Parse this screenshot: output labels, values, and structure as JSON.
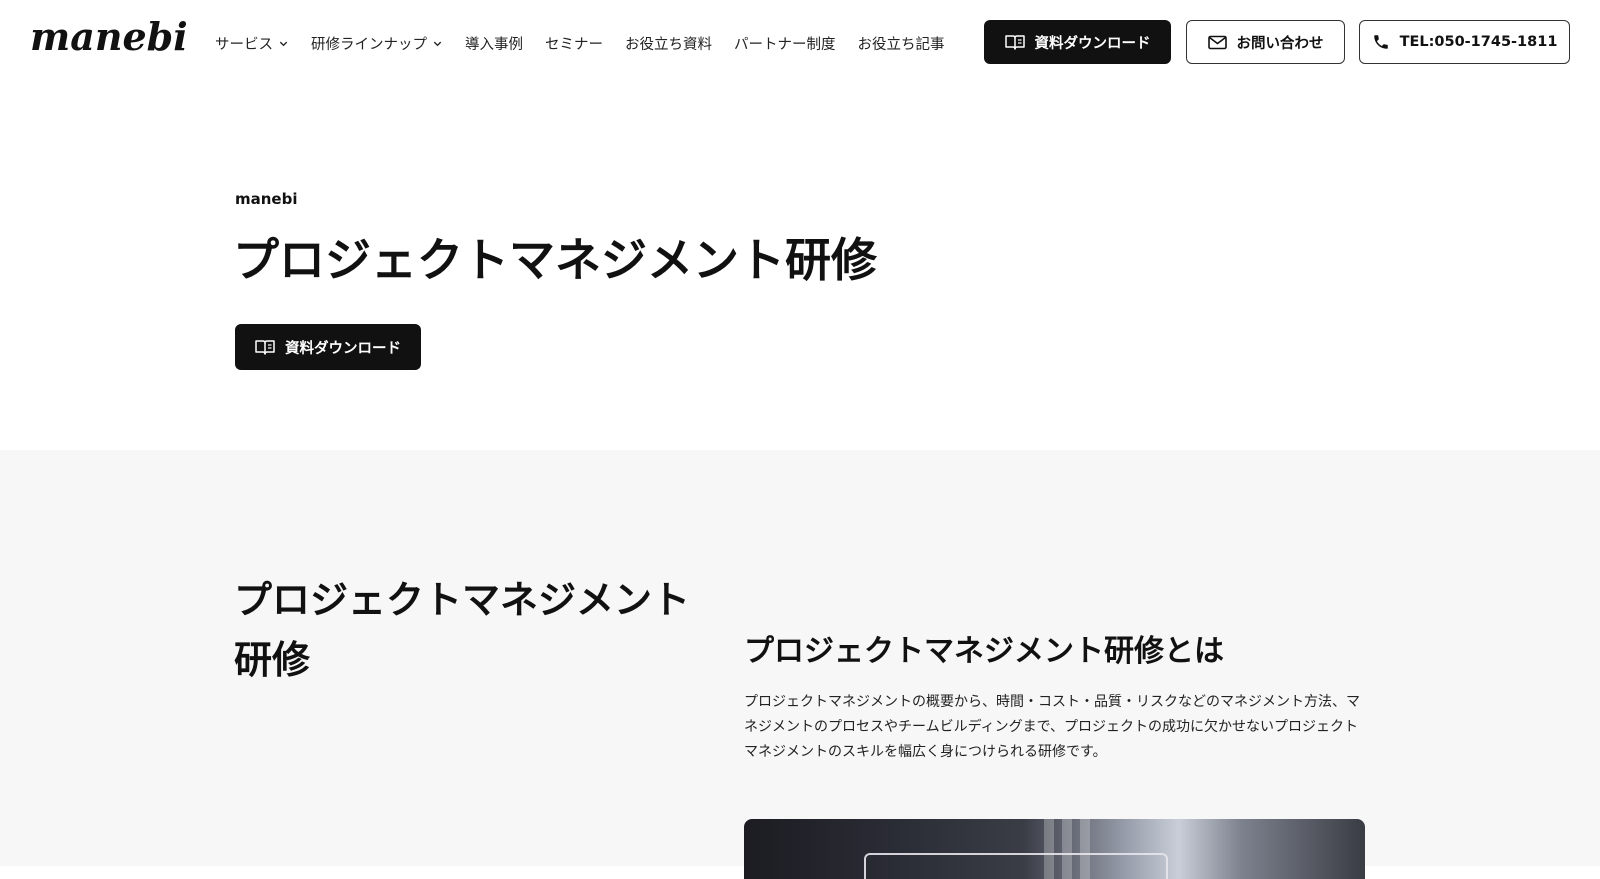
{
  "header": {
    "logo": "manebi",
    "nav": [
      {
        "label": "サービス",
        "has_dropdown": true
      },
      {
        "label": "研修ラインナップ",
        "has_dropdown": true
      },
      {
        "label": "導入事例",
        "has_dropdown": false
      },
      {
        "label": "セミナー",
        "has_dropdown": false
      },
      {
        "label": "お役立ち資料",
        "has_dropdown": false
      },
      {
        "label": "パートナー制度",
        "has_dropdown": false
      },
      {
        "label": "お役立ち記事",
        "has_dropdown": false
      }
    ],
    "download_label": "資料ダウンロード",
    "contact_label": "お問い合わせ",
    "tel_label": "TEL:050-1745-1811"
  },
  "hero": {
    "brand": "manebi",
    "title": "プロジェクトマネジメント研修",
    "download_label": "資料ダウンロード"
  },
  "section": {
    "left_title": "プロジェクトマネジメント研修",
    "heading": "プロジェクトマネジメント研修とは",
    "body": "プロジェクトマネジメントの概要から、時間・コスト・品質・リスクなどのマネジメント方法、マネジメントのプロセスやチームビルディングまで、プロジェクトの成功に欠かせないプロジェクトマネジメントのスキルを幅広く身につけられる研修です。"
  },
  "colors": {
    "primary": "#111111",
    "section_bg": "#f7f7f7",
    "page_bg": "#ffffff"
  },
  "icons": {
    "download": "book-open-icon",
    "contact": "mail-icon",
    "tel": "phone-icon",
    "dropdown": "chevron-down-icon"
  }
}
